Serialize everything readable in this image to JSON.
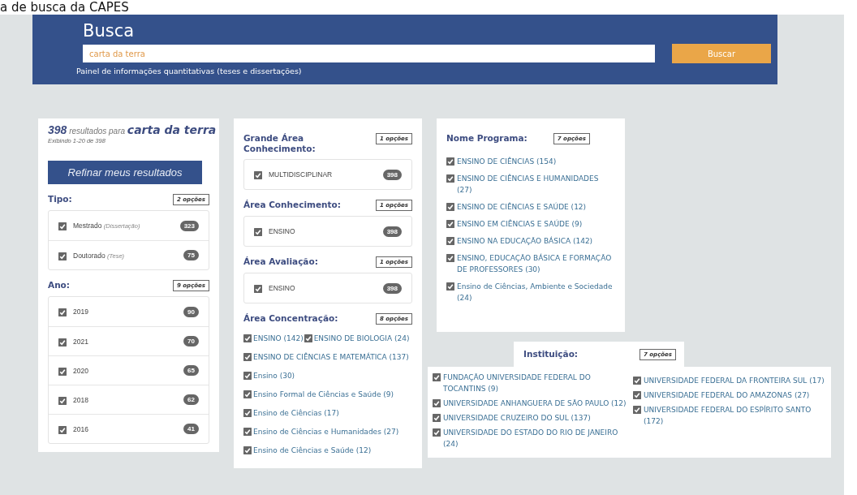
{
  "caption": "a de busca da CAPES",
  "header": {
    "title": "Busca",
    "search": {
      "value": "carta da terra"
    },
    "search_button": "Buscar",
    "panel_link": "Painel de informações quantitativas (teses e dissertações)"
  },
  "results": {
    "count": "398",
    "label": "resultados para",
    "query": "carta da terra",
    "showing": "Exibindo 1-20 de 398",
    "refine_button": "Refinar meus resultados"
  },
  "columns": [
    [
      {
        "kind": "boxed",
        "title": "Tipo:",
        "options": "2 opções",
        "items": [
          {
            "label": "Mestrado",
            "note": "(Dissertação)",
            "count": "323",
            "checked": true
          },
          {
            "label": "Doutorado",
            "note": "(Tese)",
            "count": "75",
            "checked": true
          }
        ]
      },
      {
        "kind": "boxed",
        "title": "Ano:",
        "options": "9 opções",
        "items": [
          {
            "label": "2019",
            "count": "90",
            "checked": true
          },
          {
            "label": "2021",
            "count": "70",
            "checked": true
          },
          {
            "label": "2020",
            "count": "65",
            "checked": true
          },
          {
            "label": "2018",
            "count": "62",
            "checked": true
          },
          {
            "label": "2016",
            "count": "41",
            "checked": true
          }
        ]
      }
    ],
    [
      {
        "kind": "boxed",
        "title": "Grande Área Conhecimento:",
        "options": "1 opções",
        "items": [
          {
            "label": "MULTIDISCIPLINAR",
            "count": "398",
            "checked": true
          }
        ]
      },
      {
        "kind": "boxed",
        "title": "Área Conhecimento:",
        "options": "1 opções",
        "items": [
          {
            "label": "ENSINO",
            "count": "398",
            "checked": true
          }
        ]
      },
      {
        "kind": "boxed",
        "title": "Área Avaliação:",
        "options": "1 opções",
        "items": [
          {
            "label": "ENSINO",
            "count": "398",
            "checked": true
          }
        ]
      },
      {
        "kind": "list",
        "title": "Área Concentração:",
        "options": "8 opções",
        "rows": [
          [
            {
              "label": "ENSINO (142)",
              "checked": true
            },
            {
              "label": "ENSINO DE BIOLOGIA (24)",
              "checked": true
            }
          ],
          [
            {
              "label": "ENSINO DE CIÊNCIAS E MATEMÁTICA (137)",
              "checked": true
            }
          ],
          [
            {
              "label": "Ensino (30)",
              "checked": true
            }
          ],
          [
            {
              "label": "Ensino Formal de Ciências e Saúde (9)",
              "checked": true
            }
          ],
          [
            {
              "label": "Ensino de Ciências (17)",
              "checked": true
            }
          ],
          [
            {
              "label": "Ensino de Ciências e Humanidades (27)",
              "checked": true
            }
          ],
          [
            {
              "label": "Ensino de Ciências e Saúde (12)",
              "checked": true
            }
          ]
        ]
      }
    ]
  ],
  "programa": {
    "title": "Nome Programa:",
    "options": "7 opções",
    "items": [
      {
        "label": "ENSINO DE CIÊNCIAS (154)",
        "checked": true
      },
      {
        "label": "ENSINO DE CIÊNCIAS E HUMANIDADES (27)",
        "checked": true
      },
      {
        "label": "ENSINO DE CIÊNCIAS E SAÚDE (12)",
        "checked": true
      },
      {
        "label": "ENSINO EM CIÊNCIAS E SAÚDE (9)",
        "checked": true
      },
      {
        "label": "ENSINO NA EDUCAÇÃO BÁSICA (142)",
        "checked": true
      },
      {
        "label": "ENSINO, EDUCAÇÃO BÁSICA E FORMAÇÃO DE PROFESSORES (30)",
        "checked": true
      },
      {
        "label": "Ensino de Ciências, Ambiente e Sociedade (24)",
        "checked": true
      }
    ]
  },
  "instituicao": {
    "title": "Instituição:",
    "options": "7 opções",
    "columns": [
      [
        {
          "label": "FUNDAÇÃO UNIVERSIDADE FEDERAL DO TOCANTINS (9)",
          "checked": true
        },
        {
          "label": "UNIVERSIDADE ANHANGUERA DE SÃO PAULO (12)",
          "checked": true
        },
        {
          "label": "UNIVERSIDADE CRUZEIRO DO SUL (137)",
          "checked": true
        },
        {
          "label": "UNIVERSIDADE DO ESTADO DO RIO DE JANEIRO (24)",
          "checked": true
        }
      ],
      [
        {
          "label": "UNIVERSIDADE FEDERAL DA FRONTEIRA SUL (17)",
          "checked": true
        },
        {
          "label": "UNIVERSIDADE FEDERAL DO AMAZONAS (27)",
          "checked": true
        },
        {
          "label": "UNIVERSIDADE FEDERAL DO ESPÍRITO SANTO (172)",
          "checked": true
        }
      ]
    ]
  }
}
